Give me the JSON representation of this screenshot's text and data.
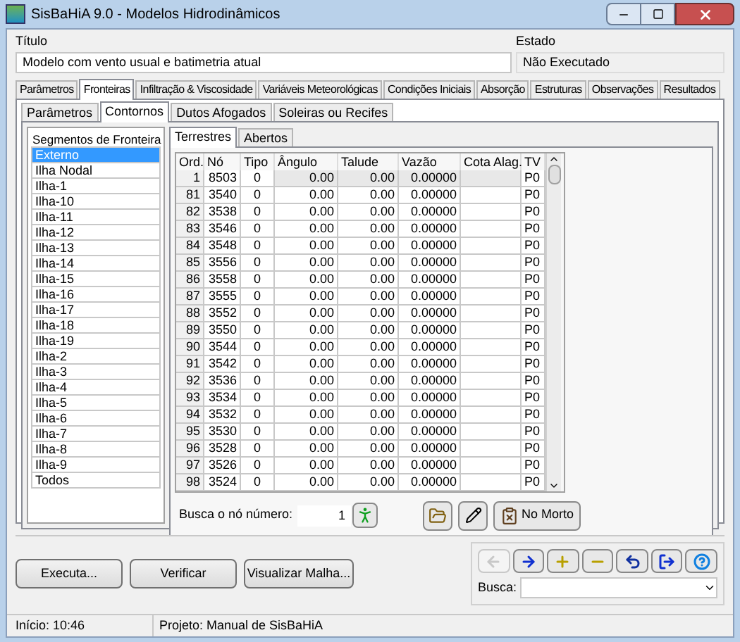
{
  "window": {
    "title": "SisBaHiA 9.0 - Modelos Hidrodinâmicos"
  },
  "title_field": {
    "label": "Título",
    "value": "Modelo com vento usual e batimetria atual"
  },
  "state_field": {
    "label": "Estado",
    "value": "Não Executado"
  },
  "tabs": [
    {
      "label": "Parâmetros",
      "selected": false
    },
    {
      "label": "Fronteiras",
      "selected": true
    },
    {
      "label": "Infiltração & Viscosidade",
      "selected": false
    },
    {
      "label": "Variáveis Meteorológicas",
      "selected": false
    },
    {
      "label": "Condições Iniciais",
      "selected": false
    },
    {
      "label": "Absorção",
      "selected": false
    },
    {
      "label": "Estruturas",
      "selected": false
    },
    {
      "label": "Observações",
      "selected": false
    },
    {
      "label": "Resultados",
      "selected": false
    }
  ],
  "subtabs": [
    {
      "label": "Parâmetros",
      "selected": false
    },
    {
      "label": "Contornos",
      "selected": true
    },
    {
      "label": "Dutos Afogados",
      "selected": false
    },
    {
      "label": "Soleiras ou Recifes",
      "selected": false
    }
  ],
  "segments": {
    "header": "Segmentos de Fronteira",
    "items": [
      {
        "label": "Externo",
        "selected": true
      },
      {
        "label": "Ilha Nodal",
        "selected": false
      },
      {
        "label": "Ilha-1",
        "selected": false
      },
      {
        "label": "Ilha-10",
        "selected": false
      },
      {
        "label": "Ilha-11",
        "selected": false
      },
      {
        "label": "Ilha-12",
        "selected": false
      },
      {
        "label": "Ilha-13",
        "selected": false
      },
      {
        "label": "Ilha-14",
        "selected": false
      },
      {
        "label": "Ilha-15",
        "selected": false
      },
      {
        "label": "Ilha-16",
        "selected": false
      },
      {
        "label": "Ilha-17",
        "selected": false
      },
      {
        "label": "Ilha-18",
        "selected": false
      },
      {
        "label": "Ilha-19",
        "selected": false
      },
      {
        "label": "Ilha-2",
        "selected": false
      },
      {
        "label": "Ilha-3",
        "selected": false
      },
      {
        "label": "Ilha-4",
        "selected": false
      },
      {
        "label": "Ilha-5",
        "selected": false
      },
      {
        "label": "Ilha-6",
        "selected": false
      },
      {
        "label": "Ilha-7",
        "selected": false
      },
      {
        "label": "Ilha-8",
        "selected": false
      },
      {
        "label": "Ilha-9",
        "selected": false
      },
      {
        "label": "Todos",
        "selected": false
      }
    ]
  },
  "boundary_tabs": [
    {
      "label": "Terrestres",
      "selected": true
    },
    {
      "label": "Abertos",
      "selected": false
    }
  ],
  "table": {
    "columns": [
      "Ord.",
      "Nó",
      "Tipo",
      "Ângulo",
      "Talude",
      "Vazão",
      "Cota Alag.",
      "TV"
    ],
    "rows": [
      [
        "1",
        "8503",
        "0",
        "0.00",
        "0.00",
        "0.00000",
        "",
        "P0"
      ],
      [
        "81",
        "3540",
        "0",
        "0.00",
        "0.00",
        "0.00000",
        "",
        "P0"
      ],
      [
        "82",
        "3538",
        "0",
        "0.00",
        "0.00",
        "0.00000",
        "",
        "P0"
      ],
      [
        "83",
        "3546",
        "0",
        "0.00",
        "0.00",
        "0.00000",
        "",
        "P0"
      ],
      [
        "84",
        "3548",
        "0",
        "0.00",
        "0.00",
        "0.00000",
        "",
        "P0"
      ],
      [
        "85",
        "3556",
        "0",
        "0.00",
        "0.00",
        "0.00000",
        "",
        "P0"
      ],
      [
        "86",
        "3558",
        "0",
        "0.00",
        "0.00",
        "0.00000",
        "",
        "P0"
      ],
      [
        "87",
        "3555",
        "0",
        "0.00",
        "0.00",
        "0.00000",
        "",
        "P0"
      ],
      [
        "88",
        "3552",
        "0",
        "0.00",
        "0.00",
        "0.00000",
        "",
        "P0"
      ],
      [
        "89",
        "3550",
        "0",
        "0.00",
        "0.00",
        "0.00000",
        "",
        "P0"
      ],
      [
        "90",
        "3544",
        "0",
        "0.00",
        "0.00",
        "0.00000",
        "",
        "P0"
      ],
      [
        "91",
        "3542",
        "0",
        "0.00",
        "0.00",
        "0.00000",
        "",
        "P0"
      ],
      [
        "92",
        "3536",
        "0",
        "0.00",
        "0.00",
        "0.00000",
        "",
        "P0"
      ],
      [
        "93",
        "3534",
        "0",
        "0.00",
        "0.00",
        "0.00000",
        "",
        "P0"
      ],
      [
        "94",
        "3532",
        "0",
        "0.00",
        "0.00",
        "0.00000",
        "",
        "P0"
      ],
      [
        "95",
        "3530",
        "0",
        "0.00",
        "0.00",
        "0.00000",
        "",
        "P0"
      ],
      [
        "96",
        "3528",
        "0",
        "0.00",
        "0.00",
        "0.00000",
        "",
        "P0"
      ],
      [
        "97",
        "3526",
        "0",
        "0.00",
        "0.00",
        "0.00000",
        "",
        "P0"
      ],
      [
        "98",
        "3524",
        "0",
        "0.00",
        "0.00",
        "0.00000",
        "",
        "P0"
      ]
    ]
  },
  "node_search": {
    "label": "Busca o nó número:",
    "value": "1"
  },
  "dead_node_button": "No Morto",
  "buttons": [
    "Executa...",
    "Verificar",
    "Visualizar Malha..."
  ],
  "nav_buttons": [
    {
      "kind": "back",
      "disabled": true
    },
    {
      "kind": "forward",
      "disabled": false
    },
    {
      "kind": "add",
      "disabled": false
    },
    {
      "kind": "remove",
      "disabled": false
    },
    {
      "kind": "undo",
      "disabled": false
    },
    {
      "kind": "exit",
      "disabled": false
    },
    {
      "kind": "help",
      "disabled": false
    }
  ],
  "search": {
    "label": "Busca:"
  },
  "status_bar": [
    "Início: 10:46",
    "Projeto: Manual de SisBaHiA"
  ]
}
